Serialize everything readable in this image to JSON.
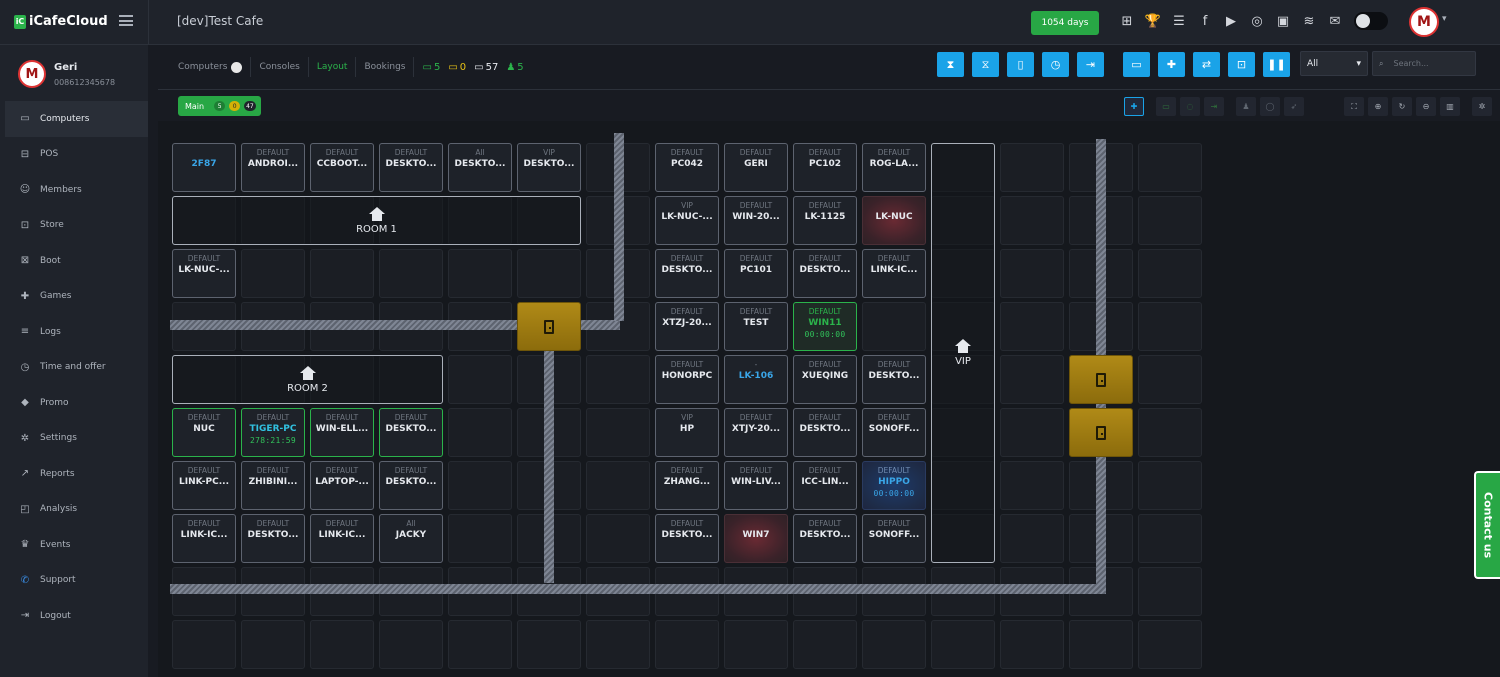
{
  "app": {
    "logo_prefix": "iC",
    "logo_text": "iCafeCloud",
    "cafe_title": "[dev]Test Cafe",
    "days_label": "1054 days",
    "avatar_letter": "M"
  },
  "top_icons": [
    {
      "name": "network-icon",
      "glyph": "⊞"
    },
    {
      "name": "trophy-icon",
      "glyph": "🏆"
    },
    {
      "name": "rss-icon",
      "glyph": "☰"
    },
    {
      "name": "facebook-icon",
      "glyph": "f"
    },
    {
      "name": "youtube-icon",
      "glyph": "▶"
    },
    {
      "name": "globe-icon",
      "glyph": "◎"
    },
    {
      "name": "icafe-app-icon",
      "glyph": "▣"
    },
    {
      "name": "logo-wings-icon",
      "glyph": "≋"
    },
    {
      "name": "mail-icon",
      "glyph": "✉"
    }
  ],
  "user": {
    "name": "Geri",
    "phone": "008612345678"
  },
  "sidebar": {
    "items": [
      {
        "label": "Computers",
        "icon": "monitor-icon",
        "glyph": "▭",
        "active": true
      },
      {
        "label": "POS",
        "icon": "pos-icon",
        "glyph": "⊟"
      },
      {
        "label": "Members",
        "icon": "members-icon",
        "glyph": "☺"
      },
      {
        "label": "Store",
        "icon": "store-icon",
        "glyph": "⊡"
      },
      {
        "label": "Boot",
        "icon": "boot-icon",
        "glyph": "⊠"
      },
      {
        "label": "Games",
        "icon": "games-icon",
        "glyph": "✚"
      },
      {
        "label": "Logs",
        "icon": "logs-icon",
        "glyph": "≡"
      },
      {
        "label": "Time and offer",
        "icon": "clock-icon",
        "glyph": "◷"
      },
      {
        "label": "Promo",
        "icon": "tag-icon",
        "glyph": "◆"
      },
      {
        "label": "Settings",
        "icon": "gear-icon",
        "glyph": "✲"
      },
      {
        "label": "Reports",
        "icon": "chart-icon",
        "glyph": "↗"
      },
      {
        "label": "Analysis",
        "icon": "analysis-icon",
        "glyph": "◰"
      },
      {
        "label": "Events",
        "icon": "events-icon",
        "glyph": "♛"
      },
      {
        "label": "Support",
        "icon": "phone-icon",
        "glyph": "✆"
      },
      {
        "label": "Logout",
        "icon": "logout-icon",
        "glyph": "⇥"
      }
    ]
  },
  "tabs": [
    {
      "label": "Computers",
      "badge": true
    },
    {
      "label": "Consoles"
    },
    {
      "label": "Layout",
      "active": true
    },
    {
      "label": "Bookings"
    }
  ],
  "counts": [
    {
      "name": "online-count",
      "glyph": "▭",
      "value": "5",
      "color": "#2bb34b"
    },
    {
      "name": "warning-count",
      "glyph": "▭",
      "value": "0",
      "color": "#e8c316"
    },
    {
      "name": "total-count",
      "glyph": "▭",
      "value": "57",
      "color": "#e6e9ee"
    },
    {
      "name": "members-count",
      "glyph": "♟",
      "value": "5",
      "color": "#2bb34b"
    }
  ],
  "action_buttons": [
    {
      "name": "hourglass-start-button",
      "glyph": "⧗"
    },
    {
      "name": "hourglass-end-button",
      "glyph": "⧖"
    },
    {
      "name": "phone-button",
      "glyph": "▯"
    },
    {
      "name": "alarm-button",
      "glyph": "◷"
    },
    {
      "name": "exit-button",
      "glyph": "⇥"
    },
    {
      "name": "ticket-button",
      "glyph": "▭"
    },
    {
      "name": "add-member-button",
      "glyph": "✚"
    },
    {
      "name": "transfer-member-button",
      "glyph": "⇄"
    },
    {
      "name": "screen-button",
      "glyph": "⊡"
    },
    {
      "name": "pause-button",
      "glyph": "❚❚"
    }
  ],
  "filter": {
    "value": "All"
  },
  "search": {
    "placeholder": "Search..."
  },
  "zone": {
    "label": "Main",
    "online": "5",
    "warning": "0",
    "total": "47"
  },
  "tools": [
    {
      "name": "add-tool",
      "glyph": "✚",
      "style": "blue"
    },
    {
      "name": "zone-view-tool",
      "glyph": "▭",
      "style": "dim"
    },
    {
      "name": "power-tool",
      "glyph": "◌",
      "style": "dim"
    },
    {
      "name": "login-tool",
      "glyph": "⇥",
      "style": "dim"
    },
    {
      "name": "user-tool",
      "glyph": "♟",
      "style": ""
    },
    {
      "name": "message-tool",
      "glyph": "◯",
      "style": ""
    },
    {
      "name": "rocket-tool",
      "glyph": "➶",
      "style": ""
    },
    {
      "name": "fit-screen-tool",
      "glyph": "⛶",
      "style": "light"
    },
    {
      "name": "zoom-in-tool",
      "glyph": "⊕",
      "style": "light"
    },
    {
      "name": "refresh-tool",
      "glyph": "↻",
      "style": "light"
    },
    {
      "name": "zoom-out-tool",
      "glyph": "⊖",
      "style": "light"
    },
    {
      "name": "delete-tool",
      "glyph": "▥",
      "style": "light"
    },
    {
      "name": "settings-tool",
      "glyph": "✲",
      "style": "light"
    }
  ],
  "rooms": [
    {
      "id": "room-1",
      "label": "ROOM 1"
    },
    {
      "id": "room-2",
      "label": "ROOM 2"
    },
    {
      "id": "vip",
      "label": "VIP"
    }
  ],
  "computers": [
    {
      "group": "",
      "name": "2F87",
      "style": "red-blue"
    },
    {
      "group": "DEFAULT",
      "name": "ANDROI..."
    },
    {
      "group": "DEFAULT",
      "name": "CCBOOT..."
    },
    {
      "group": "DEFAULT",
      "name": "DESKTO..."
    },
    {
      "group": "All",
      "name": "DESKTO..."
    },
    {
      "group": "VIP",
      "name": "DESKTO..."
    },
    {
      "group": "DEFAULT",
      "name": "PC042"
    },
    {
      "group": "DEFAULT",
      "name": "GERI"
    },
    {
      "group": "DEFAULT",
      "name": "PC102"
    },
    {
      "group": "DEFAULT",
      "name": "ROG-LA..."
    },
    {
      "group": "VIP",
      "name": "LK-NUC-..."
    },
    {
      "group": "DEFAULT",
      "name": "WIN-20..."
    },
    {
      "group": "DEFAULT",
      "name": "LK-1125"
    },
    {
      "group": "",
      "name": "LK-NUC",
      "style": "red"
    },
    {
      "group": "DEFAULT",
      "name": "LK-NUC-..."
    },
    {
      "group": "DEFAULT",
      "name": "DESKTO..."
    },
    {
      "group": "DEFAULT",
      "name": "PC101"
    },
    {
      "group": "DEFAULT",
      "name": "DESKTO..."
    },
    {
      "group": "DEFAULT",
      "name": "LINK-IC..."
    },
    {
      "group": "DEFAULT",
      "name": "XTZJ-20..."
    },
    {
      "group": "DEFAULT",
      "name": "TEST"
    },
    {
      "group": "DEFAULT",
      "name": "WIN11",
      "time": "00:00:00",
      "style": "greenfill"
    },
    {
      "group": "DEFAULT",
      "name": "HONORPC"
    },
    {
      "group": "-",
      "name": "LK-106",
      "style": "red-blue"
    },
    {
      "group": "DEFAULT",
      "name": "XUEQING"
    },
    {
      "group": "DEFAULT",
      "name": "DESKTO..."
    },
    {
      "group": "DEFAULT",
      "name": "NUC",
      "style": "green"
    },
    {
      "group": "DEFAULT",
      "name": "TIGER-PC",
      "time": "278:21:59",
      "style": "green cyan-name"
    },
    {
      "group": "DEFAULT",
      "name": "WIN-ELL...",
      "style": "green"
    },
    {
      "group": "DEFAULT",
      "name": "DESKTO...",
      "style": "green"
    },
    {
      "group": "VIP",
      "name": "HP"
    },
    {
      "group": "DEFAULT",
      "name": "XTJY-20..."
    },
    {
      "group": "DEFAULT",
      "name": "DESKTO..."
    },
    {
      "group": "DEFAULT",
      "name": "SONOFF..."
    },
    {
      "group": "DEFAULT",
      "name": "LINK-PC..."
    },
    {
      "group": "DEFAULT",
      "name": "ZHIBINI..."
    },
    {
      "group": "DEFAULT",
      "name": "LAPTOP-..."
    },
    {
      "group": "DEFAULT",
      "name": "DESKTO..."
    },
    {
      "group": "DEFAULT",
      "name": "ZHANG..."
    },
    {
      "group": "DEFAULT",
      "name": "WIN-LIV..."
    },
    {
      "group": "DEFAULT",
      "name": "ICC-LIN..."
    },
    {
      "group": "DEFAULT",
      "name": "HIPPO",
      "time": "00:00:00",
      "style": "bluefill"
    },
    {
      "group": "DEFAULT",
      "name": "LINK-IC..."
    },
    {
      "group": "DEFAULT",
      "name": "DESKTO..."
    },
    {
      "group": "DEFAULT",
      "name": "LINK-IC..."
    },
    {
      "group": "All",
      "name": "JACKY"
    },
    {
      "group": "DEFAULT",
      "name": "DESKTO..."
    },
    {
      "group": "",
      "name": "WIN7",
      "style": "red"
    },
    {
      "group": "DEFAULT",
      "name": "DESKTO..."
    },
    {
      "group": "DEFAULT",
      "name": "SONOFF..."
    }
  ],
  "contact": {
    "label": "Contact us"
  }
}
